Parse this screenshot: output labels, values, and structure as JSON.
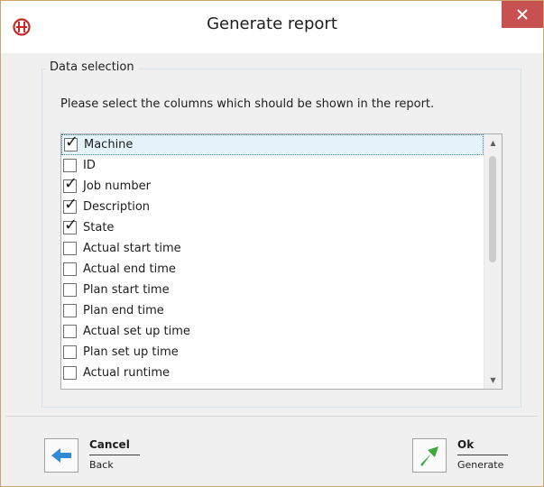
{
  "window": {
    "title": "Generate report",
    "close_icon": "close-icon",
    "app_icon": "app-logo-icon"
  },
  "group": {
    "legend": "Data selection",
    "instructions": "Please select the columns which should be shown in the report."
  },
  "columns": [
    {
      "label": "Machine",
      "checked": true,
      "selected": true
    },
    {
      "label": "ID",
      "checked": false
    },
    {
      "label": "Job number",
      "checked": true
    },
    {
      "label": "Description",
      "checked": true
    },
    {
      "label": "State",
      "checked": true
    },
    {
      "label": "Actual start time",
      "checked": false
    },
    {
      "label": "Actual end time",
      "checked": false
    },
    {
      "label": "Plan start time",
      "checked": false
    },
    {
      "label": "Plan end time",
      "checked": false
    },
    {
      "label": "Actual set up time",
      "checked": false
    },
    {
      "label": "Plan set up time",
      "checked": false
    },
    {
      "label": "Actual runtime",
      "checked": false
    }
  ],
  "actions": {
    "cancel": {
      "label": "Cancel",
      "sub": "Back",
      "icon": "back-arrow-icon"
    },
    "ok": {
      "label": "Ok",
      "sub": "Generate",
      "icon": "forward-arrow-icon"
    }
  },
  "colors": {
    "accent_close": "#c75050",
    "selection": "#e5f3fb",
    "back_arrow": "#2f8ad8",
    "ok_arrow": "#3fa83a"
  }
}
